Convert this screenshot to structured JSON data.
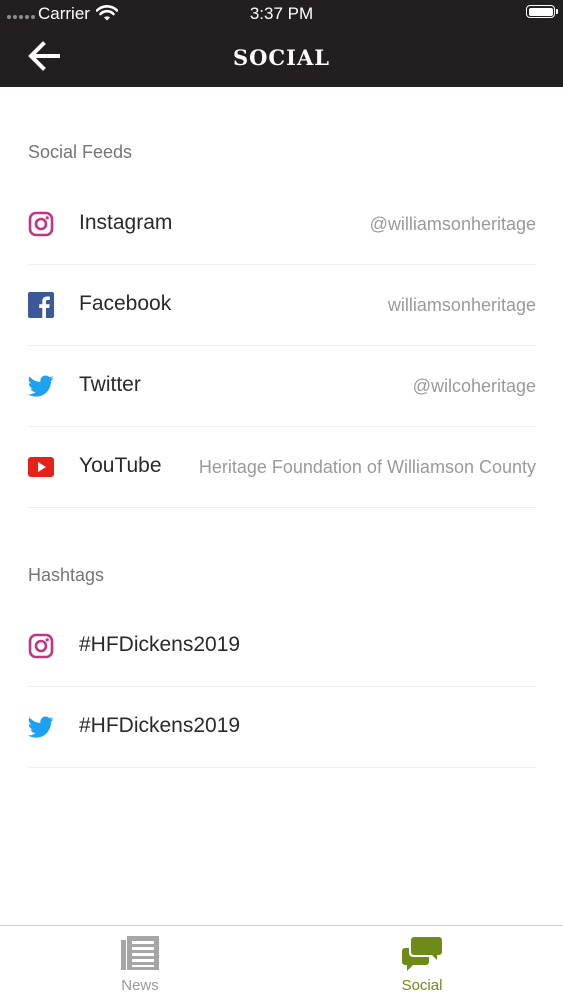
{
  "status_bar": {
    "carrier": "Carrier",
    "time": "3:37 PM"
  },
  "nav": {
    "title": "SOCIAL",
    "back_icon": "arrow-left-icon"
  },
  "sections": {
    "feeds": {
      "title": "Social Feeds",
      "items": [
        {
          "name": "Instagram",
          "handle": "@williamsonheritage",
          "icon": "instagram-icon",
          "color": "#c13584"
        },
        {
          "name": "Facebook",
          "handle": "williamsonheritage",
          "icon": "facebook-icon",
          "color": "#3b5998"
        },
        {
          "name": "Twitter",
          "handle": "@wilcoheritage",
          "icon": "twitter-icon",
          "color": "#1da1f2"
        },
        {
          "name": "YouTube",
          "handle": "Heritage Foundation of Williamson County",
          "icon": "youtube-icon",
          "color": "#e62117"
        }
      ]
    },
    "hashtags": {
      "title": "Hashtags",
      "items": [
        {
          "name": "#HFDickens2019",
          "icon": "instagram-icon",
          "color": "#c13584"
        },
        {
          "name": "#HFDickens2019",
          "icon": "twitter-icon",
          "color": "#1da1f2"
        }
      ]
    }
  },
  "tabbar": {
    "tabs": [
      {
        "label": "News",
        "icon": "newspaper-icon",
        "selected": false,
        "color": "#999999"
      },
      {
        "label": "Social",
        "icon": "speech-bubbles-icon",
        "selected": true,
        "color": "#6e8b1a"
      }
    ]
  }
}
